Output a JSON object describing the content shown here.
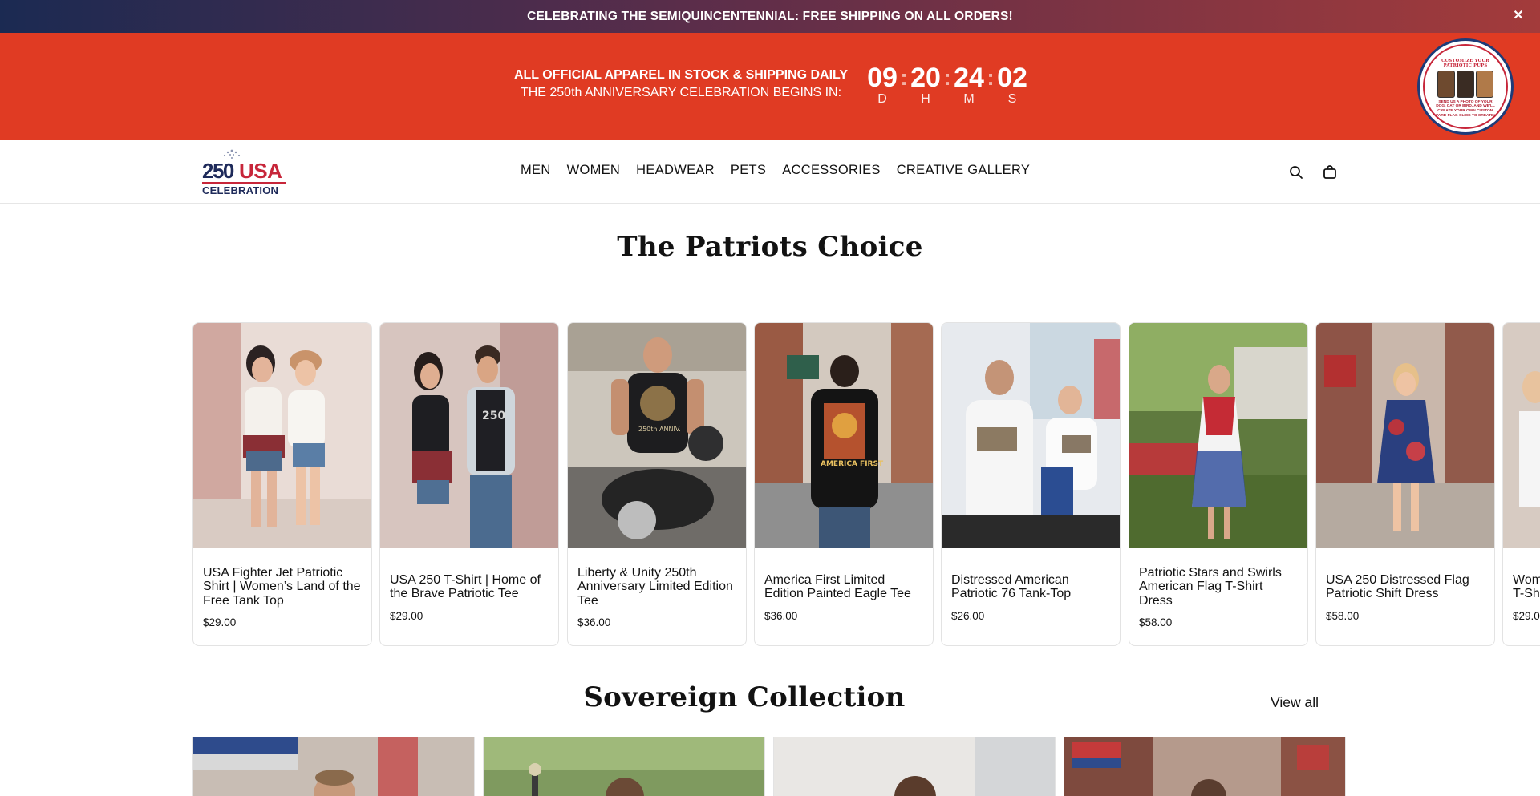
{
  "announcement": {
    "text": "CELEBRATING THE SEMIQUINCENTENNIAL: FREE SHIPPING ON ALL ORDERS!",
    "close_icon": "close-icon"
  },
  "countdown": {
    "line1": "ALL OFFICIAL APPAREL IN STOCK & SHIPPING DAILY",
    "line2": "THE 250th ANNIVERSARY CELEBRATION BEGINS IN:",
    "days": "09",
    "days_label": "D",
    "hours": "20",
    "hours_label": "H",
    "minutes": "24",
    "minutes_label": "M",
    "seconds": "02",
    "seconds_label": "S",
    "separator": ":"
  },
  "promo_badge": {
    "top_text": "CUSTOMIZE YOUR PATRIOTIC PUPS",
    "bottom_text": "SEND US A PHOTO OF YOUR DOG, CAT OR BIRD, AND WE'LL CREATE YOUR OWN CUSTOM YARD FLAG CLICK TO CREATE!"
  },
  "header": {
    "logo": {
      "number": "250",
      "country": "USA",
      "word": "CELEBRATION"
    },
    "nav": [
      "MEN",
      "WOMEN",
      "HEADWEAR",
      "PETS",
      "ACCESSORIES",
      "CREATIVE GALLERY"
    ],
    "icons": [
      "search-icon",
      "cart-icon"
    ]
  },
  "patriots_choice": {
    "title": "The Patriots Choice",
    "products": [
      {
        "title": "USA Fighter Jet Patriotic Shirt | Women’s Land of the Free Tank Top",
        "price": "$29.00"
      },
      {
        "title": "USA 250 T-Shirt | Home of the Brave Patriotic Tee",
        "price": "$29.00"
      },
      {
        "title": "Liberty & Unity 250th Anniversary Limited Edition Tee",
        "price": "$36.00"
      },
      {
        "title": "America First Limited Edition Painted Eagle Tee",
        "price": "$36.00"
      },
      {
        "title": "Distressed American Patriotic 76 Tank-Top",
        "price": "$26.00"
      },
      {
        "title": "Patriotic Stars and Swirls American Flag T-Shirt Dress",
        "price": "$58.00"
      },
      {
        "title": "USA 250 Distressed Flag Patriotic Shift Dress",
        "price": "$58.00"
      },
      {
        "title": "Wom T-Sh",
        "price": "$29.0"
      }
    ]
  },
  "sovereign_collection": {
    "title": "Sovereign Collection",
    "view_all": "View all"
  },
  "colors": {
    "countdown_red": "#e03b23",
    "navy": "#1e2a5a",
    "flag_red": "#c7263a"
  }
}
